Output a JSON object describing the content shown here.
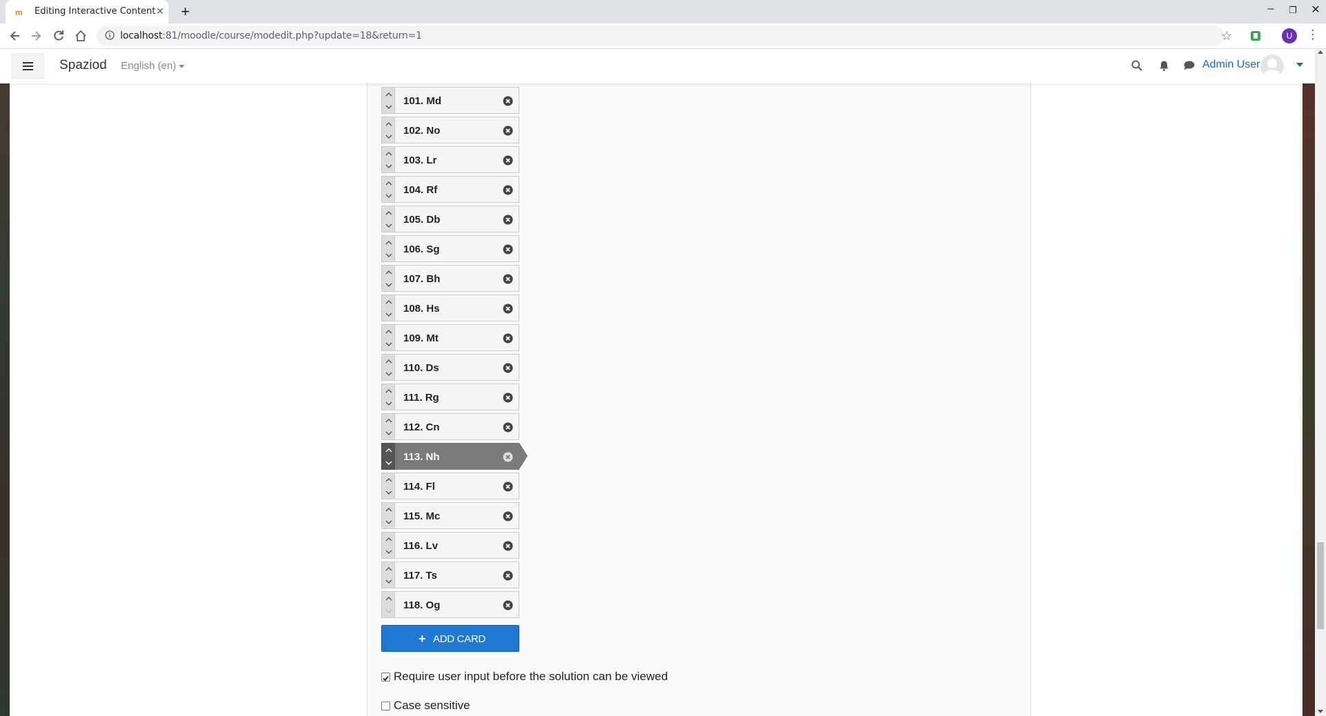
{
  "browser": {
    "tab_title": "Editing Interactive Content",
    "url_host": "localhost",
    "url_rest": ":81/moodle/course/modedit.php?update=18&return=1",
    "profile_initial": "U"
  },
  "navbar": {
    "site_name": "Spaziod",
    "language": "English (en)",
    "user_name": "Admin User"
  },
  "cards": [
    "101. Md",
    "102. No",
    "103. Lr",
    "104. Rf",
    "105. Db",
    "106. Sg",
    "107. Bh",
    "108. Hs",
    "109. Mt",
    "110. Ds",
    "111. Rg",
    "112. Cn",
    "113. Nh",
    "114. Fl",
    "115. Mc",
    "116. Lv",
    "117. Ts",
    "118. Og"
  ],
  "active_card": "113. Nh",
  "add_card_label": "ADD CARD",
  "options": {
    "require_input": {
      "label": "Require user input before the solution can be viewed",
      "checked": true
    },
    "case_sensitive": {
      "label": "Case sensitive",
      "checked": false
    }
  },
  "colors": {
    "primary": "#1f78d1",
    "link": "#0f6cbf",
    "active_card": "#7a7a7a"
  }
}
